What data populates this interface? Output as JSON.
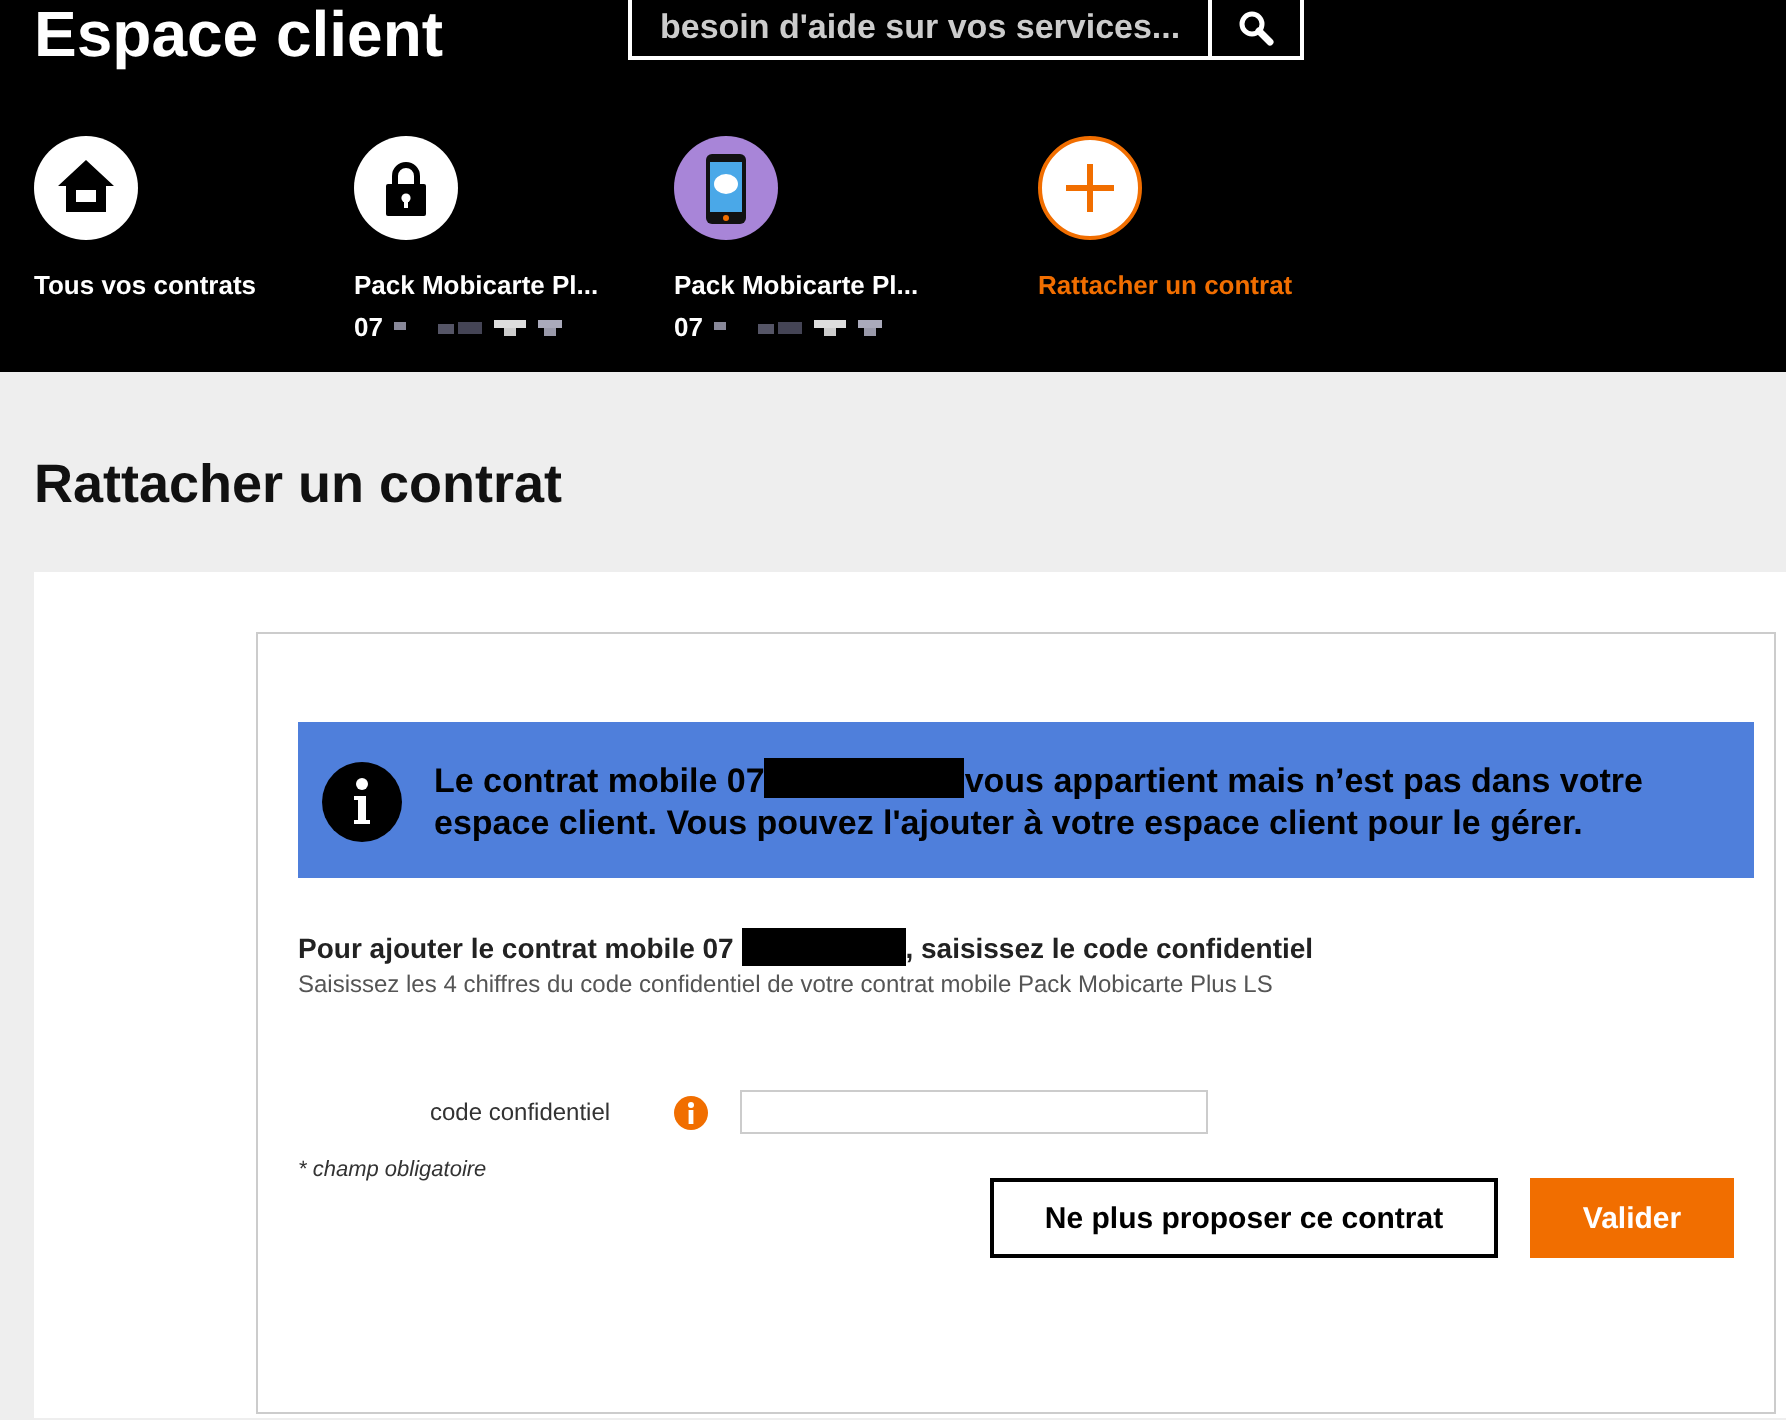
{
  "header": {
    "title": "Espace client",
    "search": {
      "placeholder": "besoin d'aide sur vos services..."
    }
  },
  "contracts": [
    {
      "kind": "home",
      "label": "Tous vos contrats",
      "selected": false
    },
    {
      "kind": "lock",
      "label": "Pack Mobicarte Pl...",
      "number": "07",
      "selected": false
    },
    {
      "kind": "phone",
      "label": "Pack Mobicarte Pl...",
      "number": "07",
      "selected": false
    },
    {
      "kind": "add",
      "label": "Rattacher un contrat",
      "selected": true
    }
  ],
  "page_title": "Rattacher un contrat",
  "notice": {
    "text_before": "Le contrat mobile 07",
    "text_after": "vous appartient mais n’est pas dans votre espace client. Vous pouvez l'ajouter à votre espace client pour le gérer."
  },
  "form": {
    "heading_before": "Pour ajouter le contrat mobile 07",
    "heading_after": ", saisissez le code confidentiel",
    "hint": "Saisissez les 4 chiffres du code confidentiel de votre contrat mobile Pack Mobicarte Plus LS",
    "field_label": "code confidentiel",
    "required_note": "* champ obligatoire"
  },
  "buttons": [
    {
      "kind": "secondary",
      "label": "Ne plus proposer ce contrat"
    },
    {
      "kind": "primary",
      "label": "Valider"
    }
  ]
}
